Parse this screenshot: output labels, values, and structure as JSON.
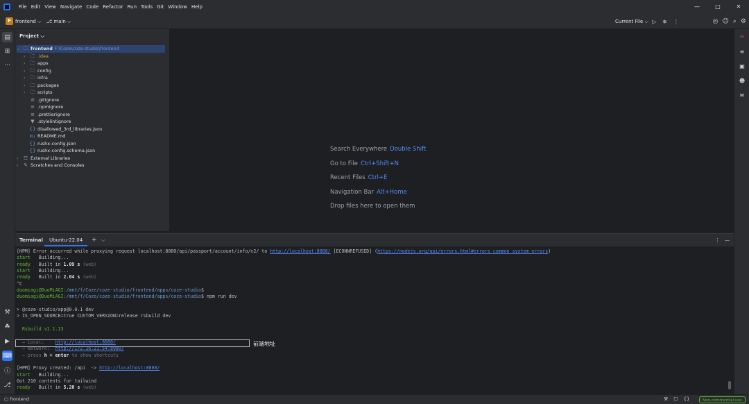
{
  "titlebar": {
    "menu": [
      "File",
      "Edit",
      "View",
      "Navigate",
      "Code",
      "Refactor",
      "Run",
      "Tools",
      "Git",
      "Window",
      "Help"
    ]
  },
  "toolbar": {
    "project_badge": "F",
    "project": "frontend",
    "branch": "main",
    "current_file": "Current File"
  },
  "project": {
    "header": "Project",
    "root_name": "frontend",
    "root_path": "F:\\Coze\\coze-studio\\frontend",
    "items": [
      {
        "name": ".idea",
        "kind": "folder"
      },
      {
        "name": "apps",
        "kind": "folder"
      },
      {
        "name": "config",
        "kind": "folder"
      },
      {
        "name": "infra",
        "kind": "folder"
      },
      {
        "name": "packages",
        "kind": "folder"
      },
      {
        "name": "scripts",
        "kind": "folder"
      },
      {
        "name": ".gitignore",
        "kind": "ignore"
      },
      {
        "name": ".npmignore",
        "kind": "text"
      },
      {
        "name": ".prettierignore",
        "kind": "text"
      },
      {
        "name": ".stylelintignore",
        "kind": "stylelint"
      },
      {
        "name": "disallowed_3rd_libraries.json",
        "kind": "json"
      },
      {
        "name": "README.md",
        "kind": "md"
      },
      {
        "name": "rushx-config.json",
        "kind": "json"
      },
      {
        "name": "rushx-config.schema.json",
        "kind": "json"
      }
    ],
    "external_libraries": "External Libraries",
    "scratches": "Scratches and Consoles"
  },
  "editor": {
    "hints": [
      {
        "label": "Search Everywhere",
        "shortcut": "Double Shift"
      },
      {
        "label": "Go to File",
        "shortcut": "Ctrl+Shift+N"
      },
      {
        "label": "Recent Files",
        "shortcut": "Ctrl+E"
      },
      {
        "label": "Navigation Bar",
        "shortcut": "Alt+Home"
      },
      {
        "label": "Drop files here to open them",
        "shortcut": ""
      }
    ]
  },
  "terminal": {
    "title": "Terminal",
    "tab": "Ubuntu-22.04",
    "l1a": "[HPM] Error occurred while proxying request localhost:8080/api/passport/account/info/v2/ to ",
    "l1b": "http://localhost:8888/",
    "l1c": " [ECONNREFUSED] (",
    "l1d": "https://nodejs.org/api/errors.html#errors_common_system_errors",
    "l1e": ")",
    "start1": "start",
    "start1_msg": "   Building...",
    "ready1": "ready",
    "ready1_msg": "   Built in ",
    "ready1_time": "1.09 s",
    "ready1_tag": " (web)",
    "start2": "start",
    "start2_msg": "   Building...",
    "ready2": "ready",
    "ready2_msg": "   Built in ",
    "ready2_time": "2.04 s",
    "ready2_tag": " (web)",
    "ctrlc": "^C",
    "prompt1_user": "duomiagi@DuoMiAGI",
    "prompt1_path": ":/mnt/f/Coze/coze-studio/frontend/apps/coze-studio",
    "prompt1_end": "$",
    "prompt2_user": "duomiagi@DuoMiAGI",
    "prompt2_path": ":/mnt/f/Coze/coze-studio/frontend/apps/coze-studio",
    "prompt2_end": "$ npm run dev",
    "pkg_line": "> @coze-studio/app@0.0.1 dev",
    "cmd_line": "> IS_OPEN_SOURCE=true CUSTOM_VERSION=release rsbuild dev",
    "rsbuild": "  Rsbuild v1.1.13",
    "local_label": "  → Local:    ",
    "local_url": "http://localhost:8080/",
    "network_label": "  → Network:  ",
    "network_url": "http://172.16.21.54:8080/",
    "press_a": "  → press ",
    "press_key": "h + enter",
    "press_b": " to show shortcuts",
    "hpm_proxy_a": "[HPM] Proxy created: /api  -> ",
    "hpm_proxy_url": "http://localhost:8888/",
    "start3": "start",
    "start3_msg": "   Building...",
    "got_line": "Got 210 contents for tailwind",
    "ready3": "ready",
    "ready3_msg": "   Built in ",
    "ready3_time": "5.20 s",
    "ready3_tag": " (web)",
    "annotation": "前端地址"
  },
  "statusbar": {
    "project": "frontend",
    "license": "Non-commercial use"
  }
}
